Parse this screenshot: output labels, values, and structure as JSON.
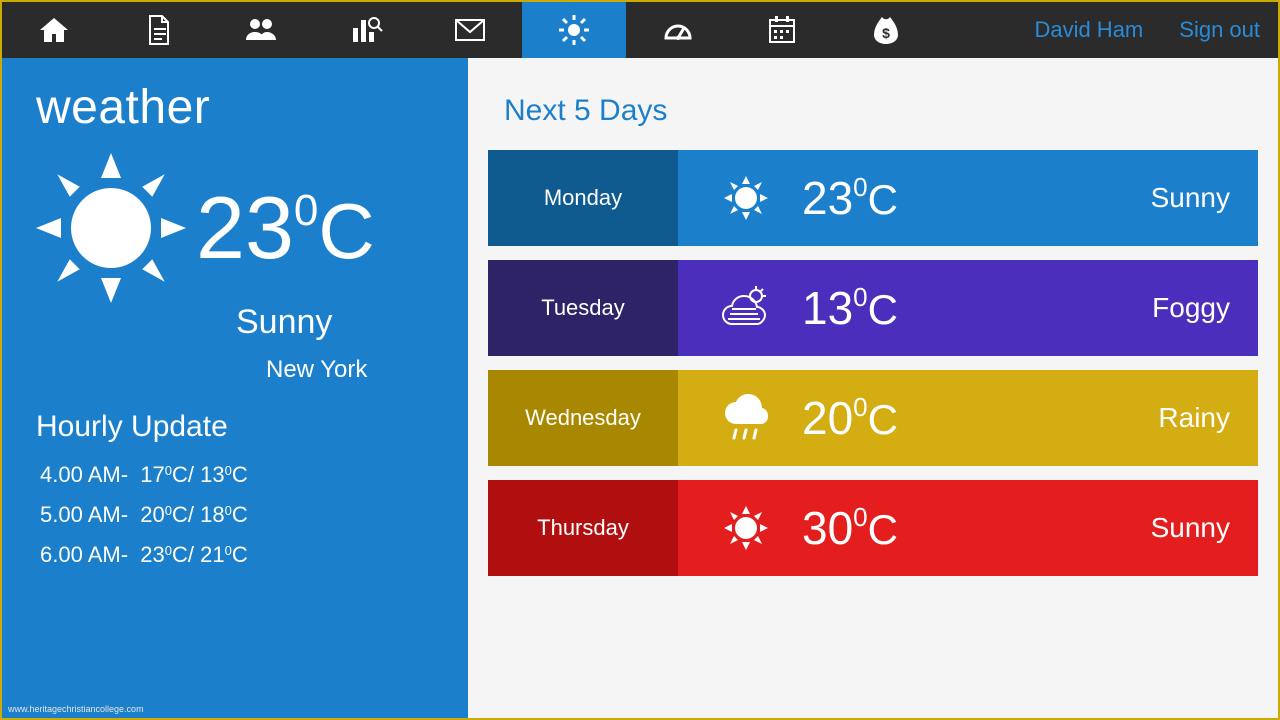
{
  "nav": {
    "items": [
      "home",
      "document",
      "people",
      "analytics",
      "mail",
      "weather",
      "dashboard",
      "calendar",
      "money"
    ],
    "active_index": 5,
    "user": "David Ham",
    "signout": "Sign out"
  },
  "current": {
    "title": "weather",
    "temp": "23",
    "unit": "C",
    "condition": "Sunny",
    "location": "New York"
  },
  "hourly": {
    "title": "Hourly Update",
    "rows": [
      {
        "time": "4.00 AM",
        "hi": "17",
        "lo": "13"
      },
      {
        "time": "5.00 AM",
        "hi": "20",
        "lo": "18"
      },
      {
        "time": "6.00 AM",
        "hi": "23",
        "lo": "21"
      }
    ]
  },
  "forecast": {
    "title": "Next 5 Days",
    "days": [
      {
        "name": "Monday",
        "icon": "sun",
        "temp": "23",
        "cond": "Sunny"
      },
      {
        "name": "Tuesday",
        "icon": "fog",
        "temp": "13",
        "cond": "Foggy"
      },
      {
        "name": "Wednesday",
        "icon": "rain",
        "temp": "20",
        "cond": "Rainy"
      },
      {
        "name": "Thursday",
        "icon": "sun",
        "temp": "30",
        "cond": "Sunny"
      }
    ]
  },
  "attribution": "www.heritagechristiancollege.com"
}
